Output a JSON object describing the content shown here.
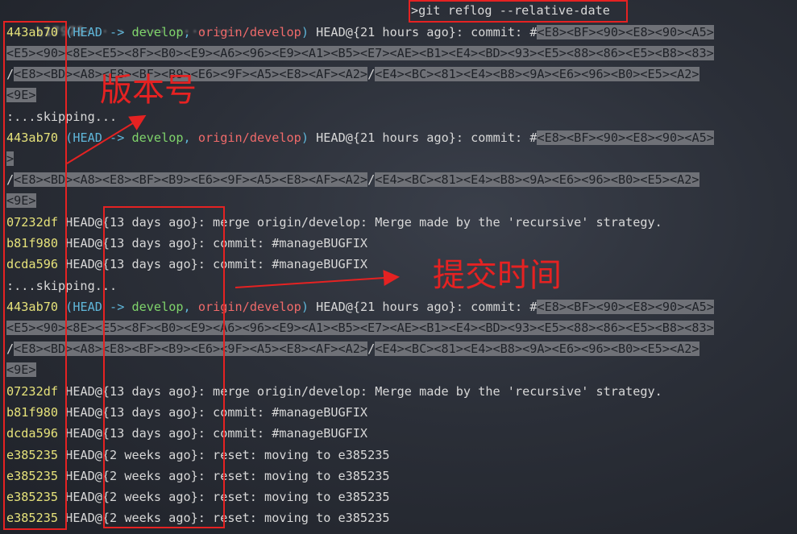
{
  "prompt": {
    "path": "\\17975··· · ···· ···· ···",
    "command": ">git reflog --relative-date"
  },
  "text": {
    "head_arrow": "HEAD ->",
    "develop": "develop",
    "origin_develop": "origin/develop",
    "skipping": ":...skipping...",
    "open_paren": "(",
    "close_paren": ")",
    "comma": ", ",
    "hash_sign": "#",
    "slash": "/",
    "gt": ">"
  },
  "encoded": {
    "a1": "<E8><BF><90><E8><90><A5>",
    "b_full": "<E5><90><8E><E5><8F><B0><E9><A6><96><E9><A1><B5><E7><AE><B1><E4><BD><93><E5><88><86><E5><B8><83>",
    "c1": "<E8><BD><A8><E8><BF><B9><E6><9F><A5><E8><AF><A2>",
    "c2": "<E4><BC><81><E4><B8><9A><E6><96><B0><E5><A2>",
    "d": "<9E>"
  },
  "reflog_top": {
    "hash": "443ab70",
    "ref": "HEAD@{21 hours ago}: commit: "
  },
  "entries_a": [
    {
      "hash": "07232df",
      "time": "HEAD@{13 days ago}",
      "msg": ": merge origin/develop: Merge made by the 'recursive' strategy."
    },
    {
      "hash": "b81f980",
      "time": "HEAD@{13 days ago}",
      "msg": ": commit: #manageBUGFIX"
    },
    {
      "hash": "dcda596",
      "time": "HEAD@{13 days ago}",
      "msg": ": commit: #manageBUGFIX"
    }
  ],
  "entries_b": [
    {
      "hash": "07232df",
      "time": "HEAD@{13 days ago}",
      "msg": ": merge origin/develop: Merge made by the 'recursive' strategy."
    },
    {
      "hash": "b81f980",
      "time": "HEAD@{13 days ago}",
      "msg": ": commit: #manageBUGFIX"
    },
    {
      "hash": "dcda596",
      "time": "HEAD@{13 days ago}",
      "msg": ": commit: #manageBUGFIX"
    },
    {
      "hash": "e385235",
      "time": "HEAD@{2 weeks ago}",
      "msg": ": reset: moving to e385235"
    },
    {
      "hash": "e385235",
      "time": "HEAD@{2 weeks ago}",
      "msg": ": reset: moving to e385235"
    },
    {
      "hash": "e385235",
      "time": "HEAD@{2 weeks ago}",
      "msg": ": reset: moving to e385235"
    },
    {
      "hash": "e385235",
      "time": "HEAD@{2 weeks ago}",
      "msg": ": reset: moving to e385235"
    }
  ],
  "annotations": {
    "version_label": "版本号",
    "time_label": "提交时间"
  },
  "colors": {
    "annotation_red": "#e52222",
    "hash_yellow": "#e6e27a",
    "branch_green": "#7fd46b",
    "remote_red": "#ef6a6a",
    "head_cyan": "#5fb6d9"
  }
}
